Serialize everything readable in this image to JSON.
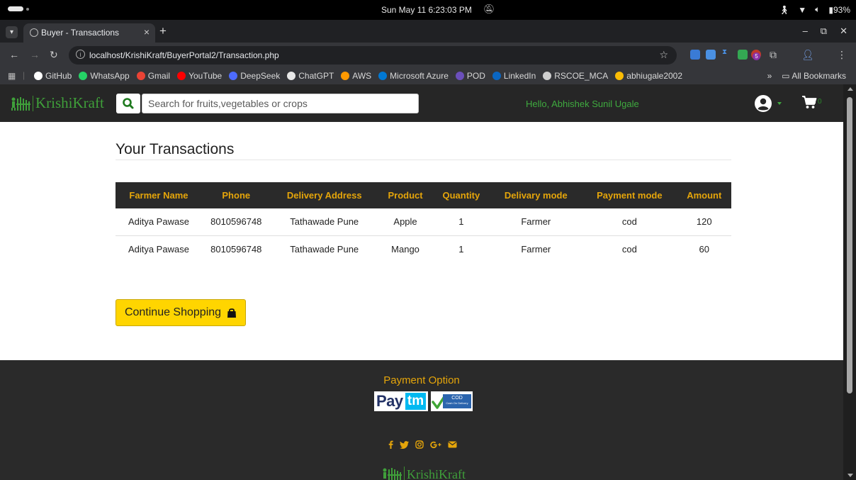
{
  "os": {
    "clock": "Sun May 11   6:23:03 PM",
    "battery": "93%"
  },
  "browser": {
    "tab_title": "Buyer - Transactions",
    "url": "localhost/KrishiKraft/BuyerPortal2/Transaction.php",
    "ext_badge": "5",
    "bookmarks": [
      {
        "label": "GitHub",
        "color": "#ffffff"
      },
      {
        "label": "WhatsApp",
        "color": "#25d366"
      },
      {
        "label": "Gmail",
        "color": "#ea4335"
      },
      {
        "label": "YouTube",
        "color": "#ff0000"
      },
      {
        "label": "DeepSeek",
        "color": "#4d6bfe"
      },
      {
        "label": "ChatGPT",
        "color": "#e8e8e8"
      },
      {
        "label": "AWS",
        "color": "#ff9900"
      },
      {
        "label": "Microsoft Azure",
        "color": "#0078d4"
      },
      {
        "label": "POD",
        "color": "#6b4fbb"
      },
      {
        "label": "LinkedIn",
        "color": "#0a66c2"
      },
      {
        "label": "RSCOE_MCA",
        "color": "#cfcfcf"
      },
      {
        "label": "abhiugale2002",
        "color": "#fbbc04"
      }
    ],
    "all_bookmarks": "All Bookmarks"
  },
  "site": {
    "brand": "KrishiKraft",
    "search_placeholder": "Search for fruits,vegetables or crops",
    "greeting": "Hello, Abhishek Sunil Ugale",
    "cart_count": "0"
  },
  "page": {
    "title": "Your Transactions",
    "columns": [
      "Farmer Name",
      "Phone",
      "Delivery Address",
      "Product",
      "Quantity",
      "Delivary mode",
      "Payment mode",
      "Amount"
    ],
    "rows": [
      [
        "Aditya Pawase",
        "8010596748",
        "Tathawade Pune",
        "Apple",
        "1",
        "Farmer",
        "cod",
        "120"
      ],
      [
        "Aditya Pawase",
        "8010596748",
        "Tathawade Pune",
        "Mango",
        "1",
        "Farmer",
        "cod",
        "60"
      ]
    ],
    "continue_label": "Continue Shopping"
  },
  "footer": {
    "payment_title": "Payment Option",
    "paytm_a": "Pay",
    "paytm_b": "tm",
    "cod_line1": "COD",
    "cod_line2": "Cash On Delivery",
    "socials": [
      "facebook-icon",
      "twitter-icon",
      "instagram-icon",
      "google-plus-icon",
      "mail-icon"
    ],
    "brand": "KrishiKraft"
  },
  "colors": {
    "accent_gold": "#e5a50a",
    "brand_green": "#3f9f3a",
    "nav_bg": "#262626",
    "button_yellow": "#ffd500"
  }
}
